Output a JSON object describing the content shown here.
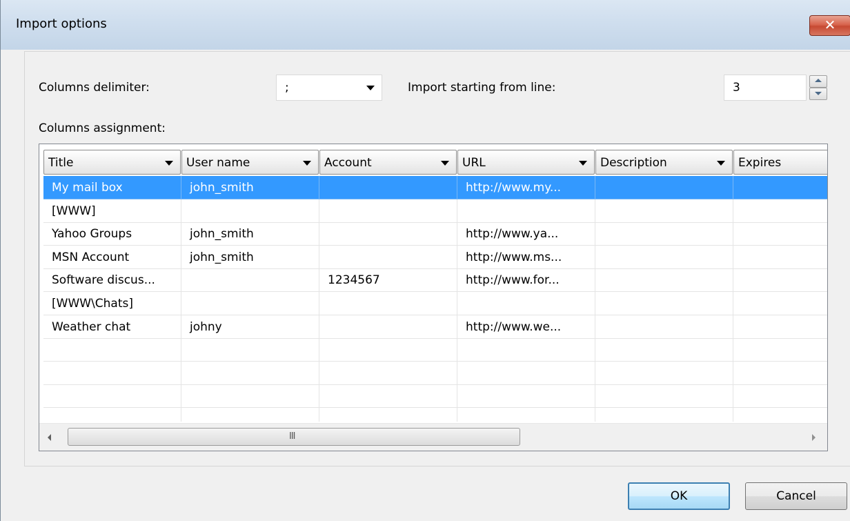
{
  "window": {
    "title": "Import options"
  },
  "options": {
    "delimiter_label": "Columns delimiter:",
    "delimiter_value": ";",
    "start_line_label": "Import starting from line:",
    "start_line_value": "3",
    "assignment_label": "Columns assignment:"
  },
  "grid": {
    "columns": [
      "Title",
      "User name",
      "Account",
      "URL",
      "Description",
      "Expires"
    ],
    "rows": [
      [
        "My mail box",
        "john_smith",
        "",
        "http://www.my...",
        "",
        ""
      ],
      [
        "[WWW]",
        "",
        "",
        "",
        "",
        ""
      ],
      [
        "Yahoo Groups",
        "john_smith",
        "",
        "http://www.ya...",
        "",
        ""
      ],
      [
        "MSN Account",
        "john_smith",
        "",
        "http://www.ms...",
        "",
        ""
      ],
      [
        "Software discus...",
        "",
        "1234567",
        "http://www.for...",
        "",
        ""
      ],
      [
        "[WWW\\Chats]",
        "",
        "",
        "",
        "",
        ""
      ],
      [
        "Weather chat",
        "johny",
        "",
        "http://www.we...",
        "",
        ""
      ],
      [
        "",
        "",
        "",
        "",
        "",
        ""
      ],
      [
        "",
        "",
        "",
        "",
        "",
        ""
      ],
      [
        "",
        "",
        "",
        "",
        "",
        ""
      ],
      [
        "",
        "",
        "",
        "",
        "",
        ""
      ]
    ],
    "selected_row": 0,
    "scroll_grip": "III"
  },
  "buttons": {
    "ok": "OK",
    "cancel": "Cancel"
  },
  "icons": {
    "close": "close-icon",
    "dropdown": "chevron-down-icon"
  },
  "colors": {
    "selection": "#3399ff",
    "title_bar": "#cfdeee",
    "close_button": "#c74a33"
  }
}
